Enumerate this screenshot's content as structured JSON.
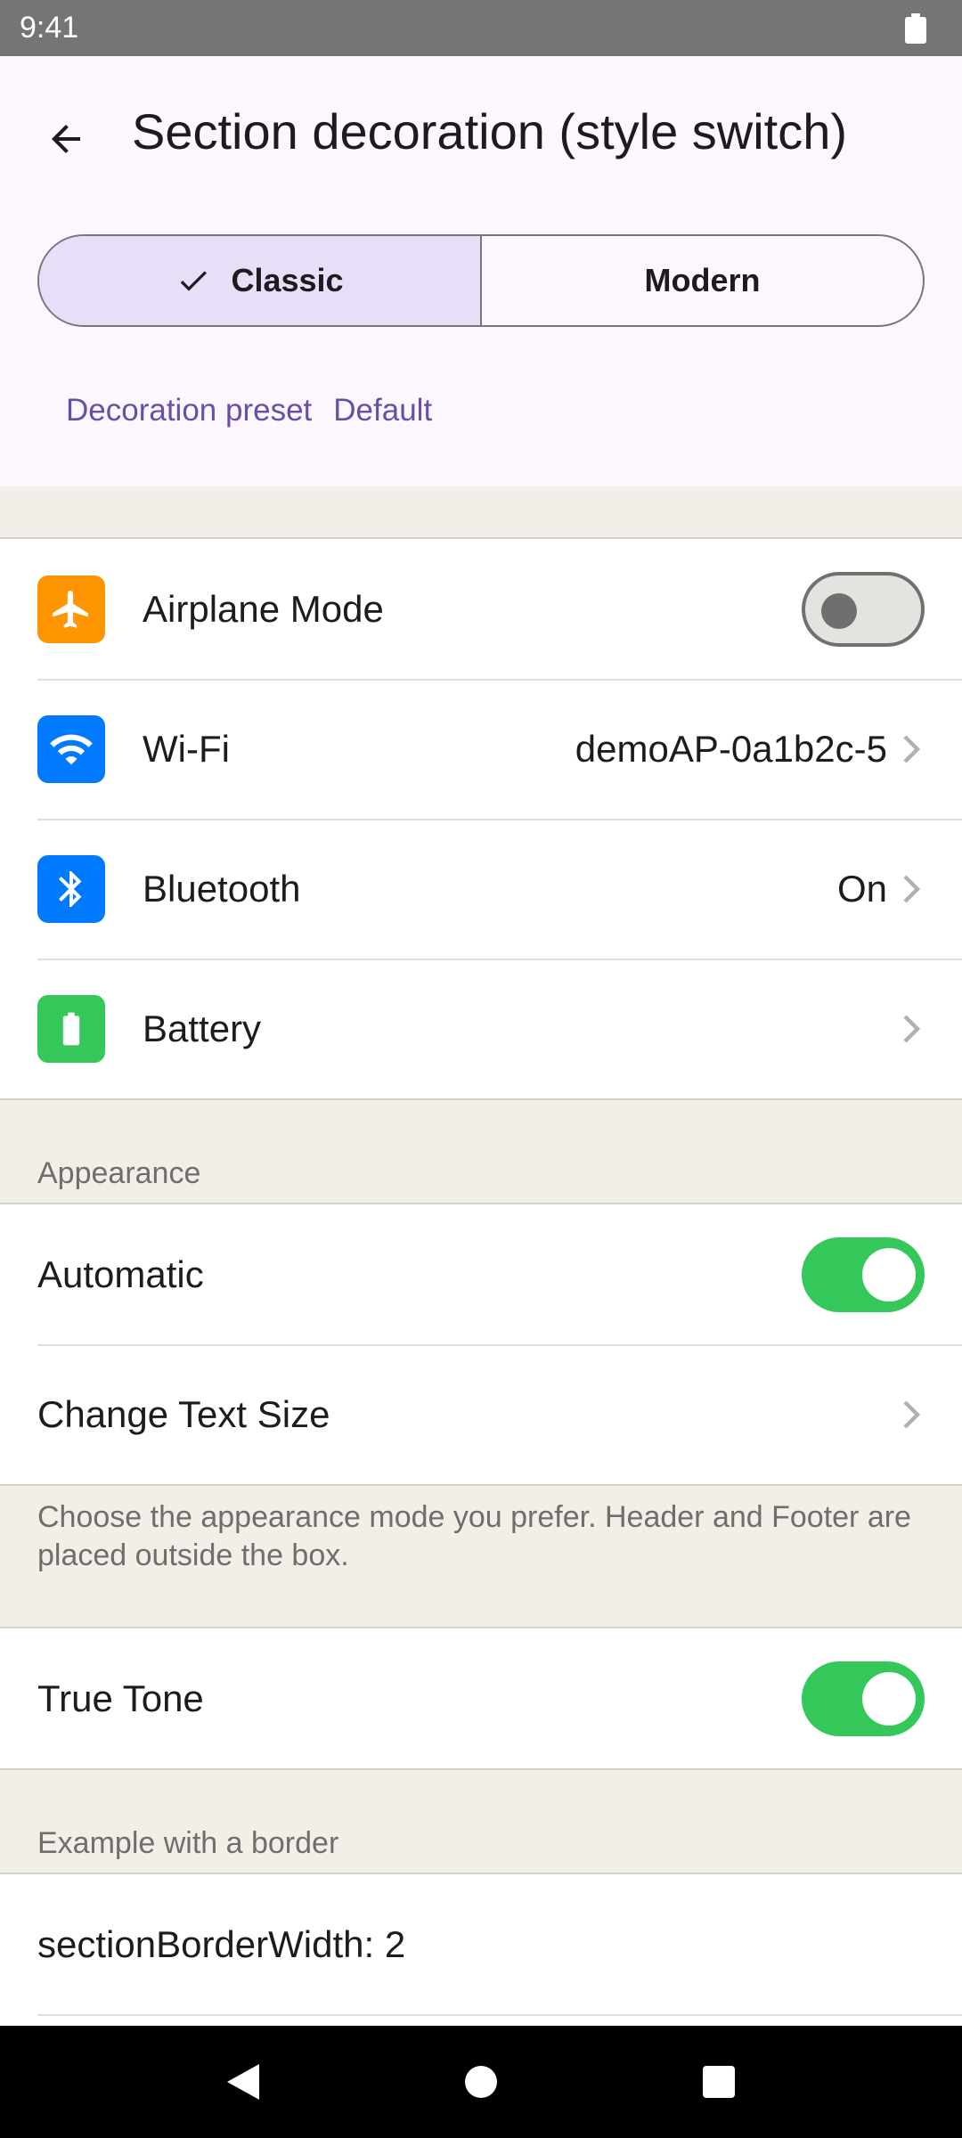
{
  "status_bar": {
    "time": "9:41"
  },
  "header": {
    "title": "Section decoration (style switch)"
  },
  "segmented": {
    "options": [
      {
        "label": "Classic",
        "selected": true
      },
      {
        "label": "Modern",
        "selected": false
      }
    ]
  },
  "preset": {
    "label": "Decoration preset",
    "value": "Default"
  },
  "group1": {
    "rows": [
      {
        "label": "Airplane Mode",
        "icon": "airplane-icon",
        "icon_color": "#ff9500",
        "toggle": false
      },
      {
        "label": "Wi-Fi",
        "icon": "wifi-icon",
        "icon_color": "#007aff",
        "value": "demoAP-0a1b2c-5"
      },
      {
        "label": "Bluetooth",
        "icon": "bluetooth-icon",
        "icon_color": "#007aff",
        "value": "On"
      },
      {
        "label": "Battery",
        "icon": "battery-icon",
        "icon_color": "#34c759",
        "value": ""
      }
    ]
  },
  "appearance": {
    "header": "Appearance",
    "rows": [
      {
        "label": "Automatic",
        "toggle": true
      },
      {
        "label": "Change Text Size"
      }
    ],
    "footer": "Choose the appearance mode you prefer. Header and Footer are placed outside the box."
  },
  "true_tone": {
    "label": "True Tone",
    "toggle": true
  },
  "border_example": {
    "header": "Example with a border",
    "rows": [
      {
        "label": "sectionBorderWidth: 2"
      }
    ]
  },
  "colors": {
    "accent": "#6750a4",
    "toggle_on": "#34c759",
    "segment_selected": "#e8def8",
    "background": "#f1efe8"
  }
}
